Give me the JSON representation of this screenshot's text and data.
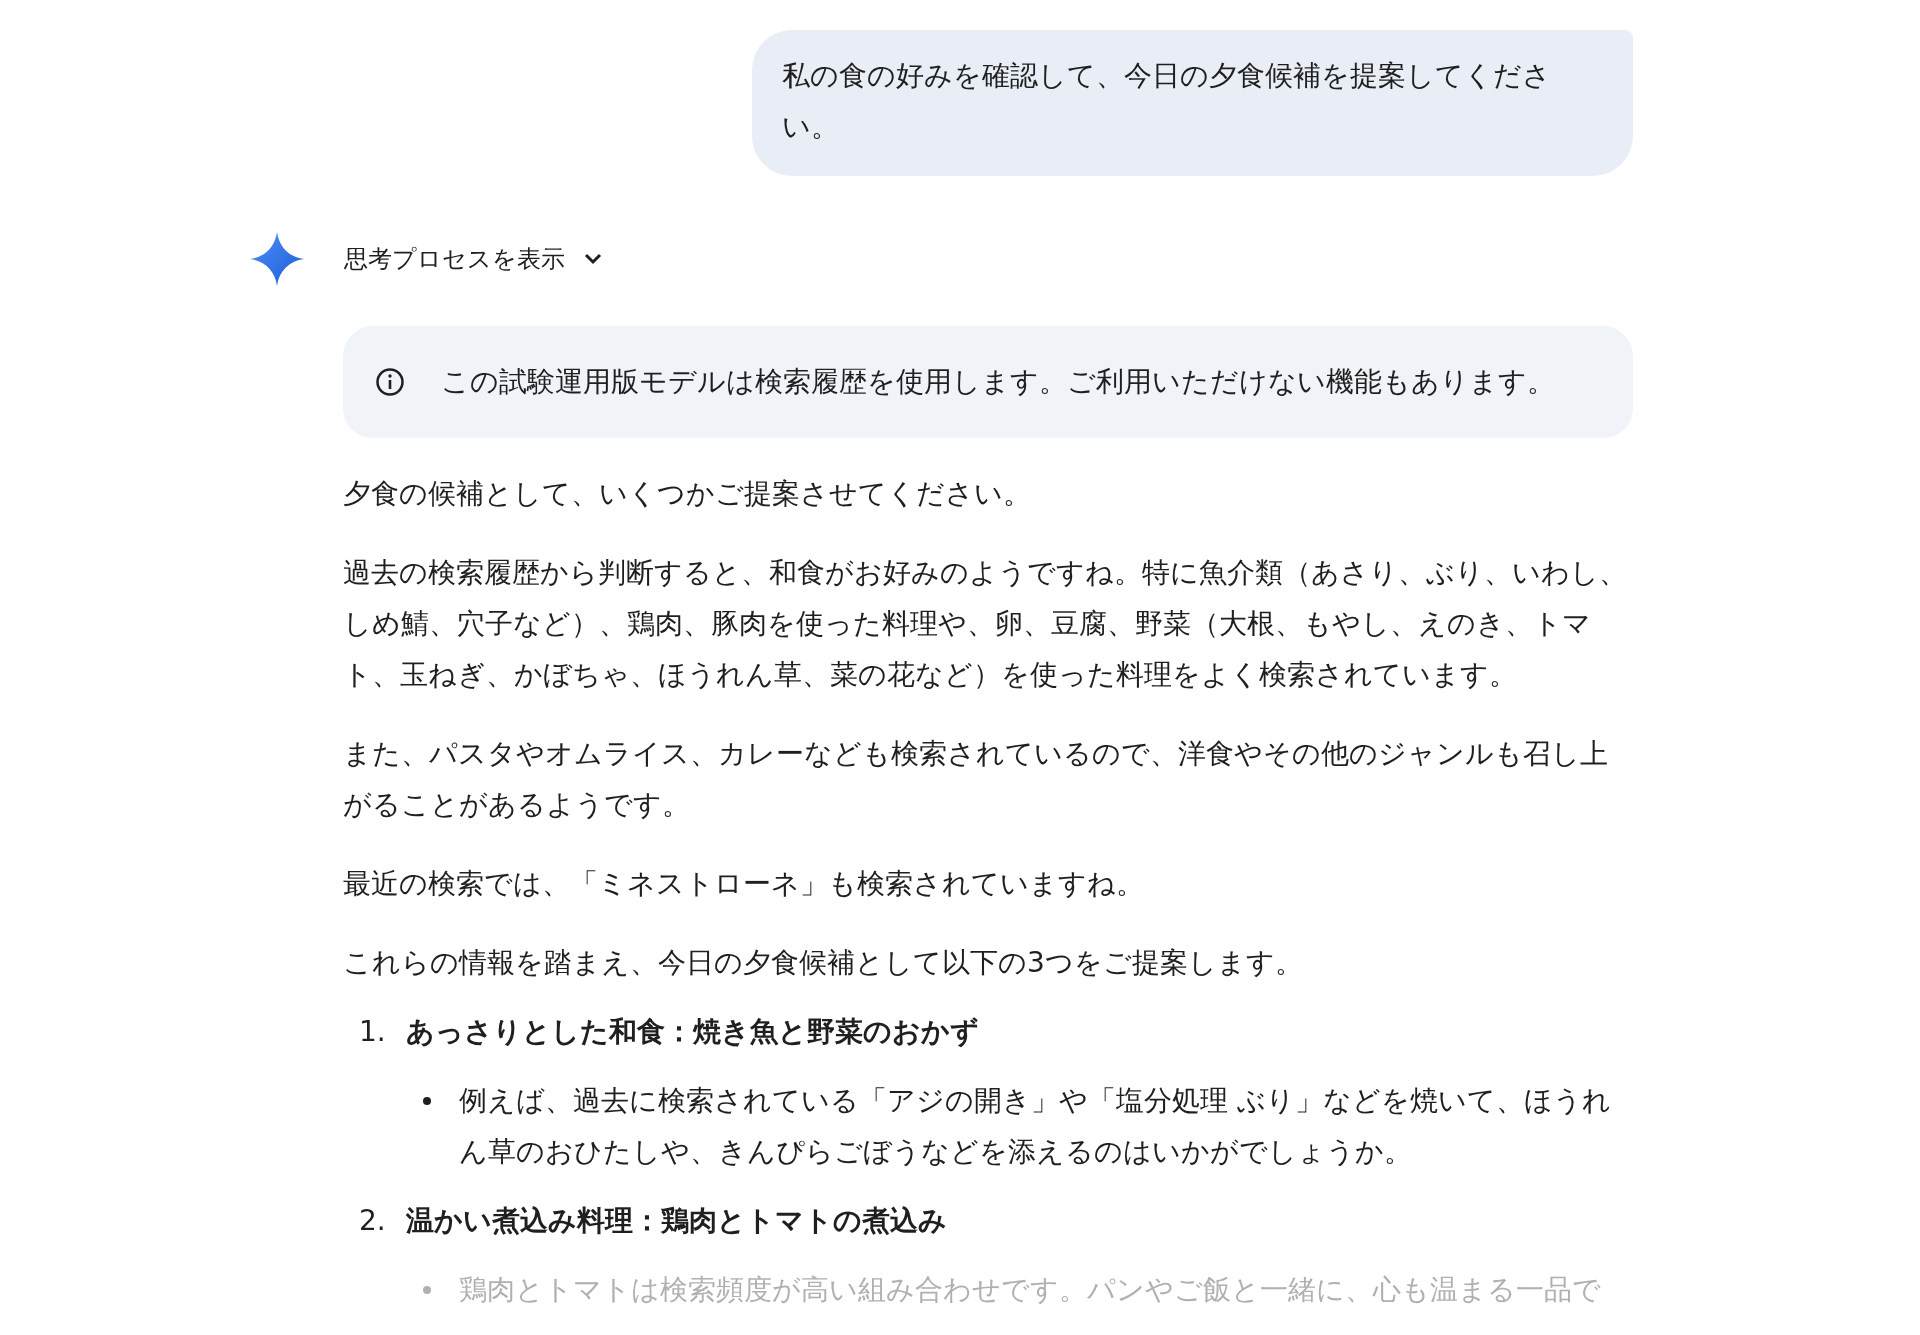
{
  "user_message": {
    "text": "私の食の好みを確認して、今日の夕食候補を提案してください。"
  },
  "response": {
    "thinking_toggle": {
      "label": "思考プロセスを表示",
      "expanded": false
    },
    "notice": {
      "text": "この試験運用版モデルは検索履歴を使用します。ご利用いただけない機能もあります。"
    },
    "paragraphs": [
      "夕食の候補として、いくつかご提案させてください。",
      "過去の検索履歴から判断すると、和食がお好みのようですね。特に魚介類（あさり、ぶり、いわし、しめ鯖、穴子など）、鶏肉、豚肉を使った料理や、卵、豆腐、野菜（大根、もやし、えのき、トマト、玉ねぎ、かぼちゃ、ほうれん草、菜の花など）を使った料理をよく検索されています。",
      "また、パスタやオムライス、カレーなども検索されているので、洋食やその他のジャンルも召し上がることがあるようです。",
      "最近の検索では、「ミネストローネ」も検索されていますね。",
      "これらの情報を踏まえ、今日の夕食候補として以下の3つをご提案します。"
    ],
    "list": [
      {
        "number": "1.",
        "title": "あっさりとした和食：焼き魚と野菜のおかず",
        "bullets": [
          {
            "text": "例えば、過去に検索されている「アジの開き」や「塩分処理 ぶり」などを焼いて、ほうれん草のおひたしや、きんぴらごぼうなどを添えるのはいかがでしょうか。",
            "faded": false
          }
        ]
      },
      {
        "number": "2.",
        "title": "温かい煮込み料理：鶏肉とトマトの煮込み",
        "bullets": [
          {
            "text": "鶏肉とトマトは検索頻度が高い組み合わせです。パンやご飯と一緒に、心も温まる一品で",
            "faded": true
          }
        ]
      }
    ]
  }
}
